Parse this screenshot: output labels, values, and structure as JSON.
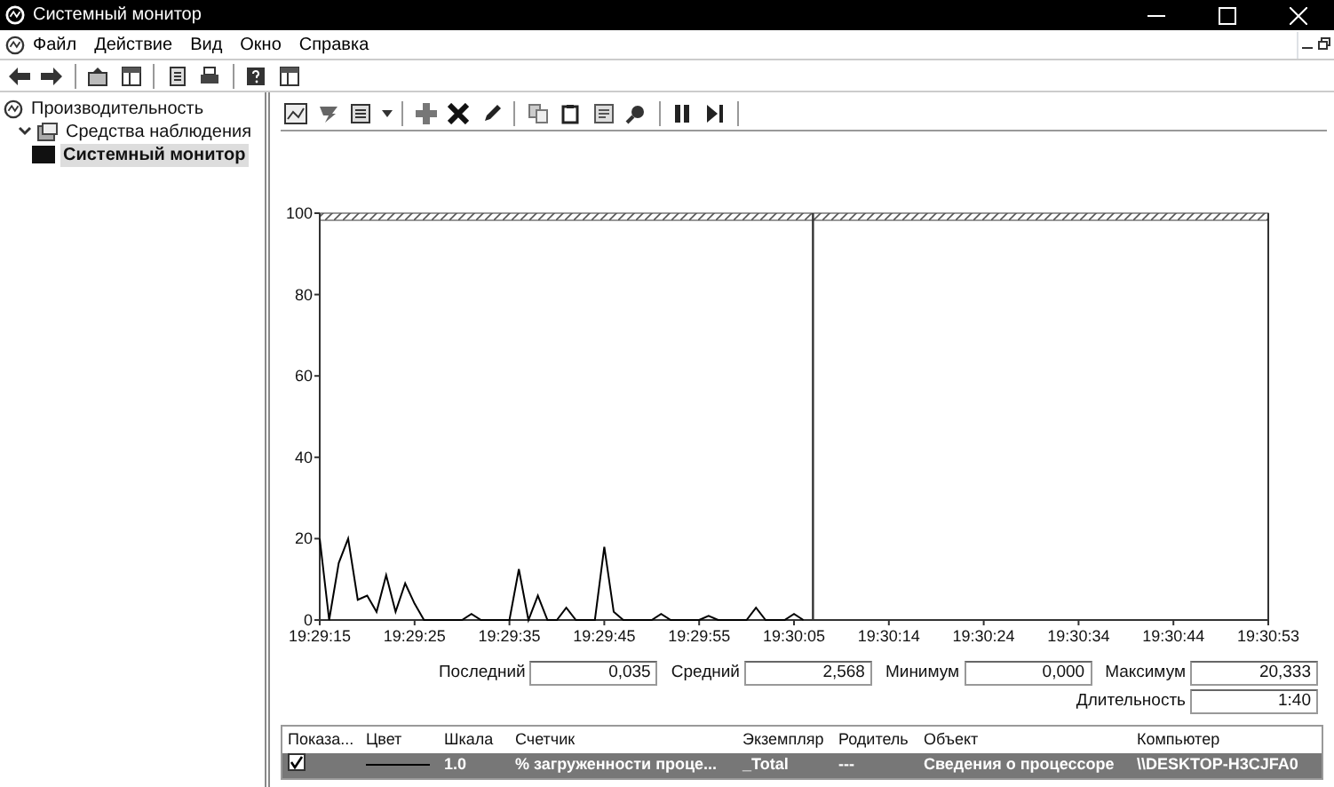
{
  "window": {
    "title": "Системный монитор"
  },
  "menu": [
    "Файл",
    "Действие",
    "Вид",
    "Окно",
    "Справка"
  ],
  "tree": [
    {
      "label": "Производительность",
      "selected": false,
      "children": [
        {
          "label": "Средства наблюдения",
          "expanded": true,
          "selected": false,
          "children": [
            {
              "label": "Системный монитор",
              "selected": true
            }
          ]
        }
      ]
    }
  ],
  "graph": {
    "chart_data": {
      "type": "line",
      "categories": [
        "19:29:15",
        null,
        null,
        null,
        null,
        null,
        null,
        null,
        null,
        null,
        "19:29:25",
        null,
        null,
        null,
        null,
        null,
        null,
        null,
        null,
        null,
        "19:29:35",
        null,
        null,
        null,
        null,
        null,
        null,
        null,
        null,
        null,
        "19:29:45",
        null,
        null,
        null,
        null,
        null,
        null,
        null,
        null,
        null,
        "19:29:55",
        null,
        null,
        null,
        null,
        null,
        null,
        null,
        null,
        null,
        "19:30:05",
        null,
        null,
        null,
        null,
        null,
        null,
        null,
        null,
        null,
        "19:30:14",
        null,
        null,
        null,
        null,
        null,
        null,
        null,
        null,
        null,
        "19:30:24",
        null,
        null,
        null,
        null,
        null,
        null,
        null,
        null,
        null,
        "19:30:34",
        null,
        null,
        null,
        null,
        null,
        null,
        null,
        null,
        null,
        "19:30:44",
        null,
        null,
        null,
        null,
        null,
        null,
        null,
        null,
        null,
        "19:30:53"
      ],
      "series": [
        {
          "color": "#000000",
          "values": [
            20,
            0,
            14,
            20,
            5,
            6,
            2,
            11,
            2,
            9,
            4,
            0,
            0,
            0,
            0,
            0,
            1.5,
            0,
            0,
            0,
            0,
            12.5,
            0,
            6,
            0,
            0,
            3,
            0,
            0,
            0,
            18,
            2,
            0,
            0,
            0,
            0,
            1.5,
            0,
            0,
            0,
            0,
            1,
            0,
            0,
            0,
            0,
            3,
            0,
            0,
            0,
            1.5,
            0,
            null,
            null,
            null,
            null,
            null,
            null,
            null,
            null,
            null,
            null,
            null,
            null,
            null,
            null,
            null,
            null,
            null,
            null,
            null,
            null,
            null,
            null,
            null,
            null,
            null,
            null,
            null,
            null,
            null,
            null,
            null,
            null,
            null,
            null,
            null,
            null,
            null,
            null,
            null,
            null,
            null,
            null,
            null,
            null,
            null,
            null,
            null,
            null,
            null
          ]
        }
      ],
      "ylim": [
        0,
        100
      ],
      "yticks": [
        0,
        20,
        40,
        60,
        80,
        100
      ]
    }
  },
  "stats": [
    {
      "label": "Последний",
      "value": "0,035"
    },
    {
      "label": "Средний",
      "value": "2,568"
    },
    {
      "label": "Минимум",
      "value": "0,000"
    },
    {
      "label": "Максимум",
      "value": "20,333"
    },
    {
      "label": "Длительность",
      "value": "1:40"
    }
  ],
  "counters": {
    "columns": [
      "Показа...",
      "Цвет",
      "Шкала",
      "Счетчик",
      "Экземпляр",
      "Родитель",
      "Объект",
      "Компьютер"
    ],
    "rows": [
      {
        "shown": true,
        "selected": true,
        "color": "#000000",
        "scale": "1.0",
        "counter": "% загруженности проце...",
        "instance": "_Total",
        "parent": "---",
        "object": "Сведения о процессоре",
        "computer": "\\\\DESKTOP-H3CJFA0"
      }
    ]
  }
}
